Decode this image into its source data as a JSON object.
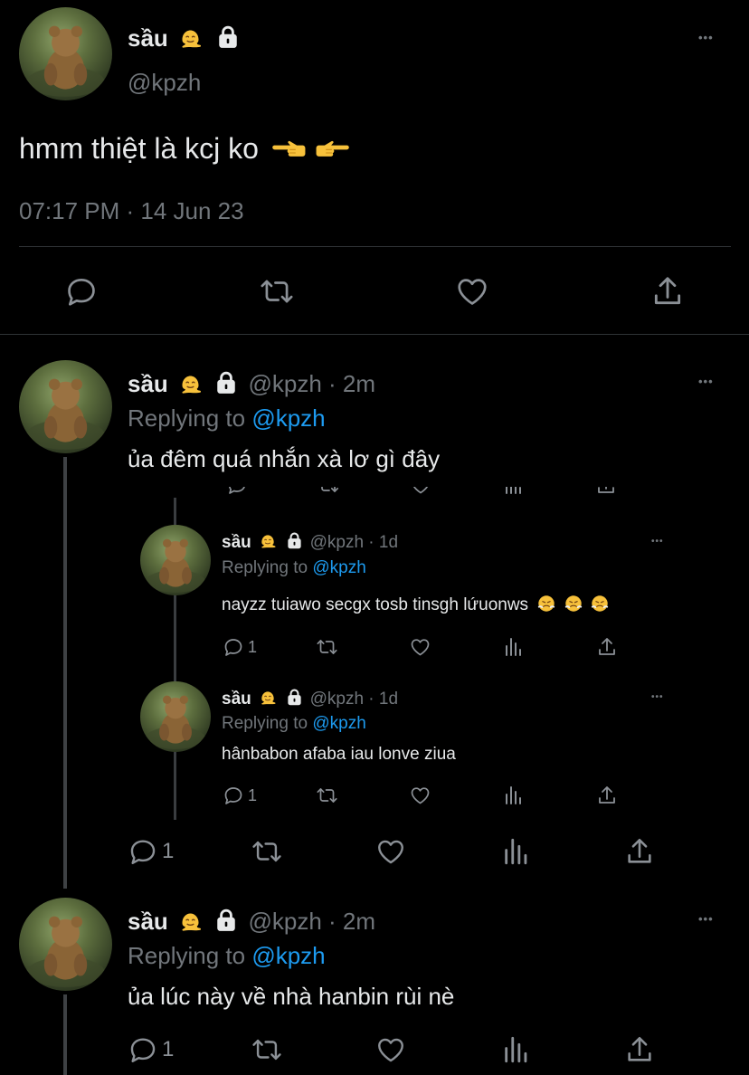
{
  "main_tweet": {
    "name": "sầu",
    "handle": "@kpzh",
    "text": "hmm thiệt là kcj ko",
    "timestamp": "07:17 PM · 14 Jun 23",
    "more": "•••"
  },
  "reply1": {
    "name": "sầu",
    "handle_time": "@kpzh · 2m",
    "replying_prefix": "Replying to",
    "replying_handle": "@kpzh",
    "text": "ủa đêm quá nhắn xà lơ gì đây",
    "more": "•••",
    "reply_count": "1"
  },
  "nested1": {
    "name": "sầu",
    "handle_time": "@kpzh · 1d",
    "replying_prefix": "Replying to",
    "replying_handle": "@kpzh",
    "text": "nayzz tuiawo secgx tosb tinsgh lứuonws",
    "more": "•••",
    "reply_count": "1"
  },
  "nested2": {
    "name": "sầu",
    "handle_time": "@kpzh · 1d",
    "replying_prefix": "Replying to",
    "replying_handle": "@kpzh",
    "text": "hânbabon afaba iau lonve ziua",
    "more": "•••",
    "reply_count": "1"
  },
  "reply2": {
    "name": "sầu",
    "handle_time": "@kpzh · 2m",
    "replying_prefix": "Replying to",
    "replying_handle": "@kpzh",
    "text": "ủa lúc này về nhà hanbin rùi nè",
    "more": "•••",
    "reply_count": "1"
  },
  "icons": {
    "reply": "reply-icon",
    "retweet": "retweet-icon",
    "like": "heart-icon",
    "views": "views-icon",
    "share": "share-icon",
    "lock": "lock-icon",
    "emoji_melting": "melting-face-emoji",
    "emoji_pointing": "pointing-hand-emoji",
    "emoji_steam": "face-with-steam-emoji"
  },
  "colors": {
    "background": "#000000",
    "text": "#e7e9ea",
    "secondary": "#71767b",
    "accent": "#1d9bf0"
  }
}
